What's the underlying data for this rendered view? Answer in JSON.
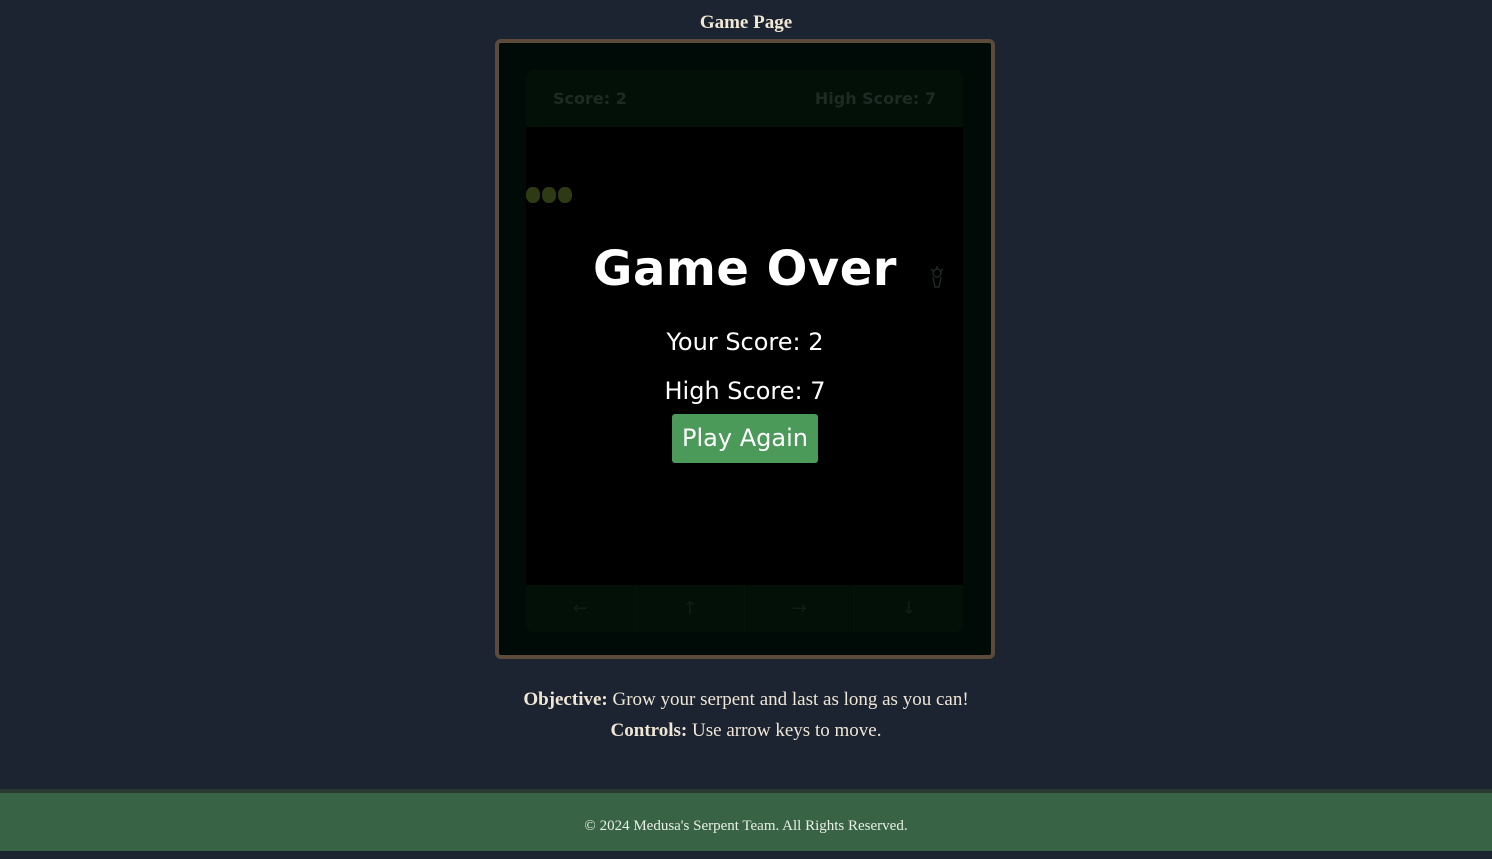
{
  "page": {
    "title": "Game Page"
  },
  "game": {
    "score_label": "Score: 2",
    "high_score_label": "High Score: 7",
    "snake_length": 3,
    "controls": [
      {
        "icon": "arrow-left-icon",
        "glyph": "←"
      },
      {
        "icon": "arrow-up-icon",
        "glyph": "↑"
      },
      {
        "icon": "arrow-right-icon",
        "glyph": "→"
      },
      {
        "icon": "arrow-down-icon",
        "glyph": "↓"
      }
    ]
  },
  "overlay": {
    "title": "Game Over",
    "your_score": "Your Score: 2",
    "high_score": "High Score: 7",
    "play_again_label": "Play Again"
  },
  "info": {
    "objective_label": "Objective:",
    "objective_text": " Grow your serpent and last as long as you can!",
    "controls_label": "Controls:",
    "controls_text": " Use arrow keys to move."
  },
  "footer": {
    "text": "© 2024 Medusa's Serpent Team. All Rights Reserved."
  },
  "colors": {
    "background": "#1b2430",
    "frame_border": "#5c4a3a",
    "button": "#4b9a5a",
    "footer": "#386445"
  }
}
